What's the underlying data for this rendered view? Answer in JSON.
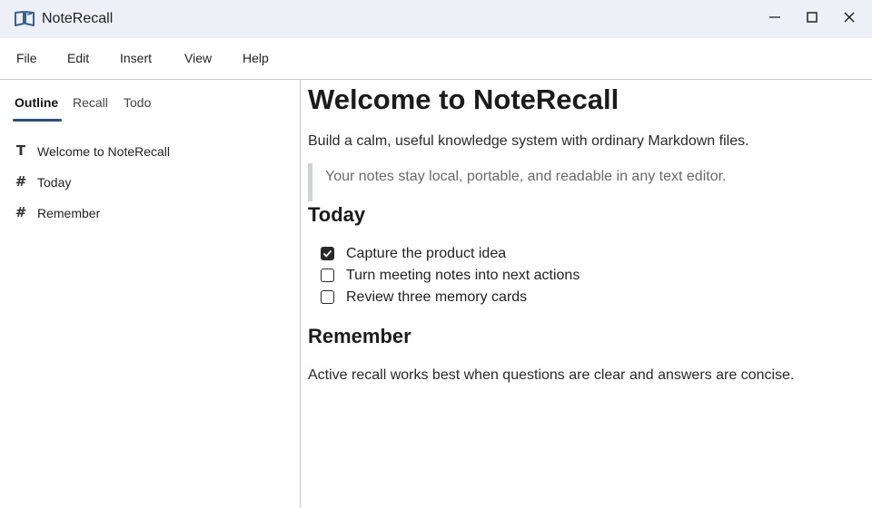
{
  "window": {
    "title": "NoteRecall",
    "icon": "open-book-icon",
    "controls": [
      "minimize-icon",
      "maximize-icon",
      "close-icon"
    ]
  },
  "menu": [
    "File",
    "Edit",
    "Insert",
    "View",
    "Help"
  ],
  "sidebar": {
    "tabs": [
      "Outline",
      "Recall",
      "Todo"
    ],
    "active_tab": "Outline",
    "outline": [
      {
        "glyph": "T",
        "icon": "heading1-icon",
        "label": "Welcome to NoteRecall"
      },
      {
        "glyph": "#",
        "icon": "heading-hash-icon",
        "label": "Today"
      },
      {
        "glyph": "#",
        "icon": "heading-hash-icon",
        "label": "Remember"
      }
    ]
  },
  "document": {
    "title": "Welcome to NoteRecall",
    "intro": "Build a calm, useful knowledge system with ordinary Markdown files.",
    "quote": "Your notes stay local, portable, and readable in any text editor.",
    "section_today": "Today",
    "tasks": [
      {
        "label": "Capture the product idea",
        "checked": true
      },
      {
        "label": "Turn meeting notes into next actions",
        "checked": false
      },
      {
        "label": "Review three memory cards",
        "checked": false
      }
    ],
    "section_remember": "Remember",
    "remember_text": "Active recall works best when questions are clear and answers are concise."
  },
  "colors": {
    "titlebar_bg": "#eef0f8",
    "accent": "#2e4f7a",
    "divider": "#c9c9c9"
  }
}
